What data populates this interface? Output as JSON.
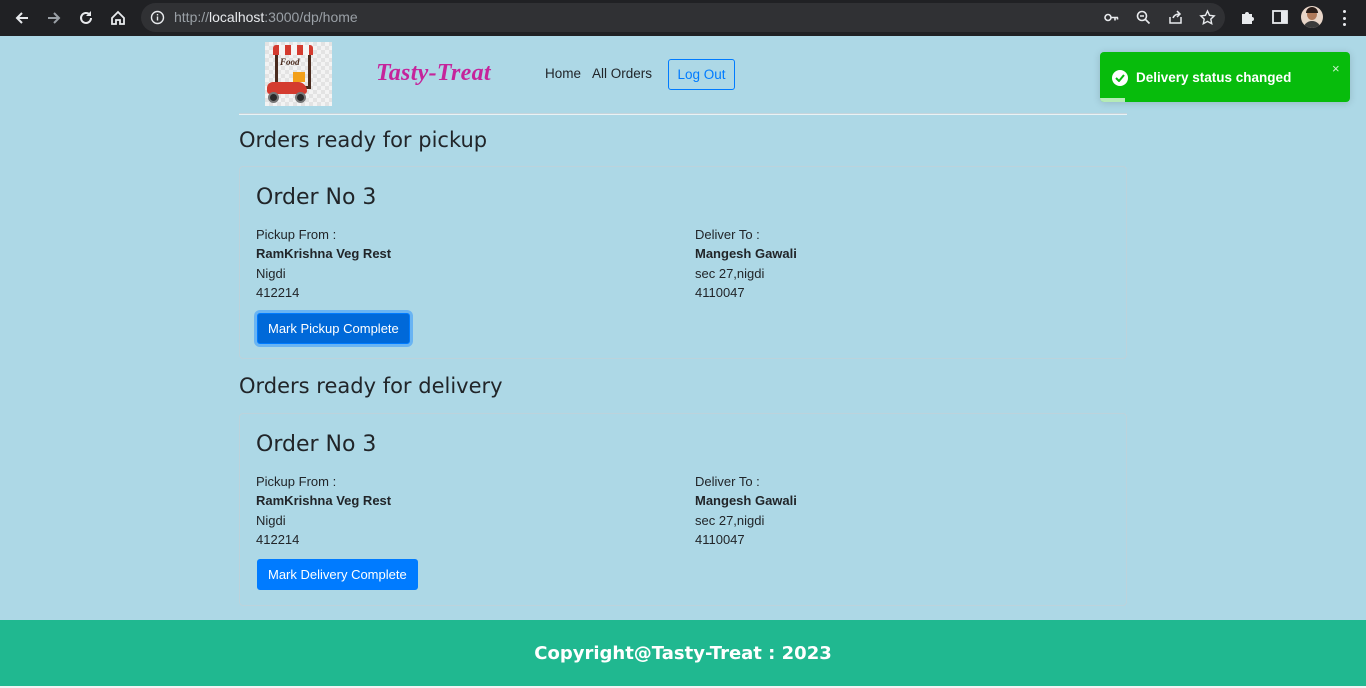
{
  "browser": {
    "url_scheme": "http://",
    "url_host": "localhost",
    "url_path": ":3000/dp/home"
  },
  "navbar": {
    "brand": "Tasty-Treat",
    "links": [
      "Home",
      "All Orders"
    ],
    "logout_label": "Log Out",
    "logo_text": "Food"
  },
  "pickup": {
    "heading": "Orders ready for pickup",
    "order_title": "Order No 3",
    "pickup_from_label": "Pickup From :",
    "pickup_name": "RamKrishna Veg Rest",
    "pickup_city": "Nigdi",
    "pickup_zip": "412214",
    "deliver_to_label": "Deliver To :",
    "deliver_name": "Mangesh Gawali",
    "deliver_address": "sec 27,nigdi",
    "deliver_zip": "4110047",
    "button_label": "Mark Pickup Complete"
  },
  "delivery": {
    "heading": "Orders ready for delivery",
    "order_title": "Order No 3",
    "pickup_from_label": "Pickup From :",
    "pickup_name": "RamKrishna Veg Rest",
    "pickup_city": "Nigdi",
    "pickup_zip": "412214",
    "deliver_to_label": "Deliver To :",
    "deliver_name": "Mangesh Gawali",
    "deliver_address": "sec 27,nigdi",
    "deliver_zip": "4110047",
    "button_label": "Mark Delivery Complete"
  },
  "toast": {
    "message": "Delivery status changed",
    "close": "×",
    "color": "#07bc0c"
  },
  "footer": {
    "text": "Copyright@Tasty-Treat : 2023",
    "color": "#20b890"
  },
  "colors": {
    "background": "#add8e6",
    "primary": "#007bff",
    "brand": "#c5249b"
  },
  "icons": [
    "back-icon",
    "forward-icon",
    "reload-icon",
    "home-icon",
    "info-icon",
    "key-icon",
    "zoom-icon",
    "share-icon",
    "star-icon",
    "extensions-icon",
    "side-panel-icon",
    "profile-avatar",
    "menu-icon",
    "check-icon",
    "close-icon"
  ]
}
